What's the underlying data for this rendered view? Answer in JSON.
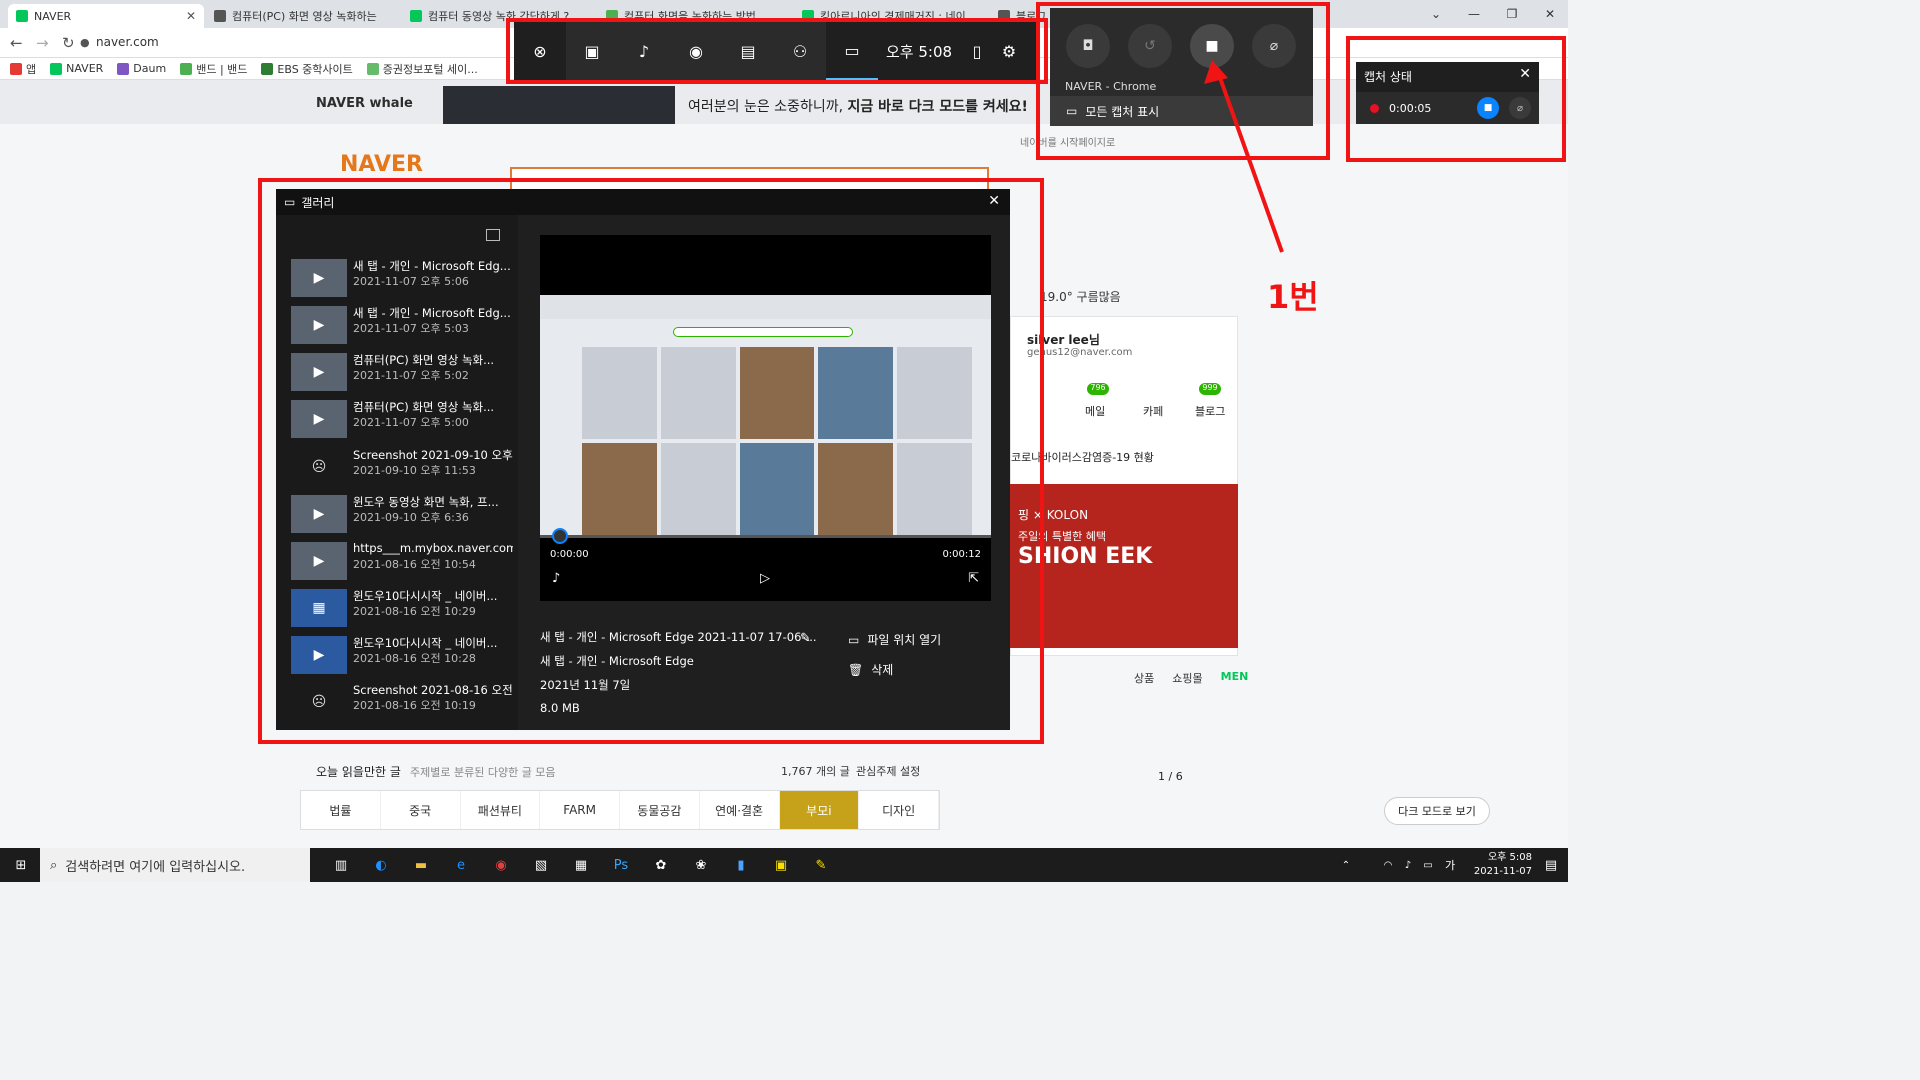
{
  "browser": {
    "tabs": [
      {
        "label": "NAVER",
        "color": "#03c75a"
      },
      {
        "label": "컴퓨터(PC) 화면 영상 녹화하는",
        "color": "#555555"
      },
      {
        "label": "컴퓨터 동영상 녹화 간단하게 ?",
        "color": "#03c75a"
      },
      {
        "label": "컴퓨터 화면을 녹화하는 방법",
        "color": "#4caf50"
      },
      {
        "label": "킹아르니아의 경제매거진 : 네이",
        "color": "#03c75a"
      },
      {
        "label": "블로그",
        "color": "#555555"
      }
    ],
    "url": "naver.com",
    "bookmarks": [
      {
        "label": "앱",
        "color": "#e53935"
      },
      {
        "label": "NAVER",
        "color": "#03c75a"
      },
      {
        "label": "Daum",
        "color": "#7e57c2"
      },
      {
        "label": "밴드 | 밴드",
        "color": "#4caf50"
      },
      {
        "label": "EBS 중학사이트",
        "color": "#2e7d32"
      },
      {
        "label": "증권정보포털 세이...",
        "color": "#66bb6a"
      }
    ]
  },
  "naver": {
    "whale": "NAVER whale",
    "banner_text": "여러분의 눈은 소중하니까, ",
    "banner_bold": "지금 바로 다크 모드를 켜세요!",
    "logo": "NAVER",
    "start_page": "네이버를 시작페이지로",
    "user_name": "silver lee님",
    "user_email": "genus12@naver.com",
    "mail": "메일",
    "cafe": "카페",
    "blog": "블로그",
    "mail_badge": "796",
    "blog_badge": "999",
    "weather": "19.0° 구름많음",
    "corona": "코로나바이러스감염증-19 현황",
    "ad_line1": "핑 × KOLON",
    "ad_line2": "주일의 특별한 혜택",
    "ad_line3": "SHION EEK",
    "today_title": "오늘 읽을만한 글",
    "today_sub": "주제별로 분류된 다양한 글 모음",
    "count": "1,767 개의 글",
    "interest": "관심주제 설정",
    "categories": [
      "법률",
      "중국",
      "패션뷰티",
      "FARM",
      "동물공감",
      "연예·결혼",
      "부모i",
      "디자인"
    ],
    "shopping": [
      "상품",
      "쇼핑몰",
      "MEN"
    ],
    "pager": "1 / 6",
    "dark_mode": "다크 모드로 보기"
  },
  "gamebar": {
    "time": "오후 5:08"
  },
  "capture": {
    "title": "NAVER - Chrome",
    "show_all": "모든 캡처 표시"
  },
  "status": {
    "title": "캡처 상태",
    "elapsed": "0:00:05"
  },
  "annotation": {
    "label": "1번"
  },
  "gallery": {
    "title": "갤러리",
    "items": [
      {
        "title": "새 탭 - 개인 - Microsoft Edg...",
        "date": "2021-11-07 오후 5:06",
        "kind": "video"
      },
      {
        "title": "새 탭 - 개인 - Microsoft Edg...",
        "date": "2021-11-07 오후 5:03",
        "kind": "video"
      },
      {
        "title": "컴퓨터(PC) 화면 영상 녹화...",
        "date": "2021-11-07 오후 5:02",
        "kind": "video"
      },
      {
        "title": "컴퓨터(PC) 화면 영상 녹화...",
        "date": "2021-11-07 오후 5:00",
        "kind": "video"
      },
      {
        "title": "Screenshot 2021-09-10 오후...",
        "date": "2021-09-10 오후 11:53",
        "kind": "image"
      },
      {
        "title": "윈도우 동영상 화면 녹화, 프...",
        "date": "2021-09-10 오후 6:36",
        "kind": "video"
      },
      {
        "title": "https___m.mybox.naver.com...",
        "date": "2021-08-16 오전 10:54",
        "kind": "video"
      },
      {
        "title": "윈도우10다시시작 _ 네이버...",
        "date": "2021-08-16 오전 10:29",
        "kind": "blue"
      },
      {
        "title": "윈도우10다시시작 _ 네이버...",
        "date": "2021-08-16 오전 10:28",
        "kind": "blue"
      },
      {
        "title": "Screenshot 2021-08-16 오전...",
        "date": "2021-08-16 오전 10:19",
        "kind": "image"
      }
    ],
    "time_start": "0:00:00",
    "time_end": "0:00:12",
    "file_name": "새 탭 - 개인 - Microsoft Edge 2021-11-07 17-06-...",
    "app": "새 탭 - 개인 - Microsoft Edge",
    "date": "2021년 11월 7일",
    "size": "8.0 MB",
    "open_location": "파일 위치 열기",
    "delete": "삭제"
  },
  "taskbar": {
    "search_placeholder": "검색하려면 여기에 입력하십시오.",
    "clock_time": "오후 5:08",
    "clock_date": "2021-11-07",
    "ime": "가"
  }
}
